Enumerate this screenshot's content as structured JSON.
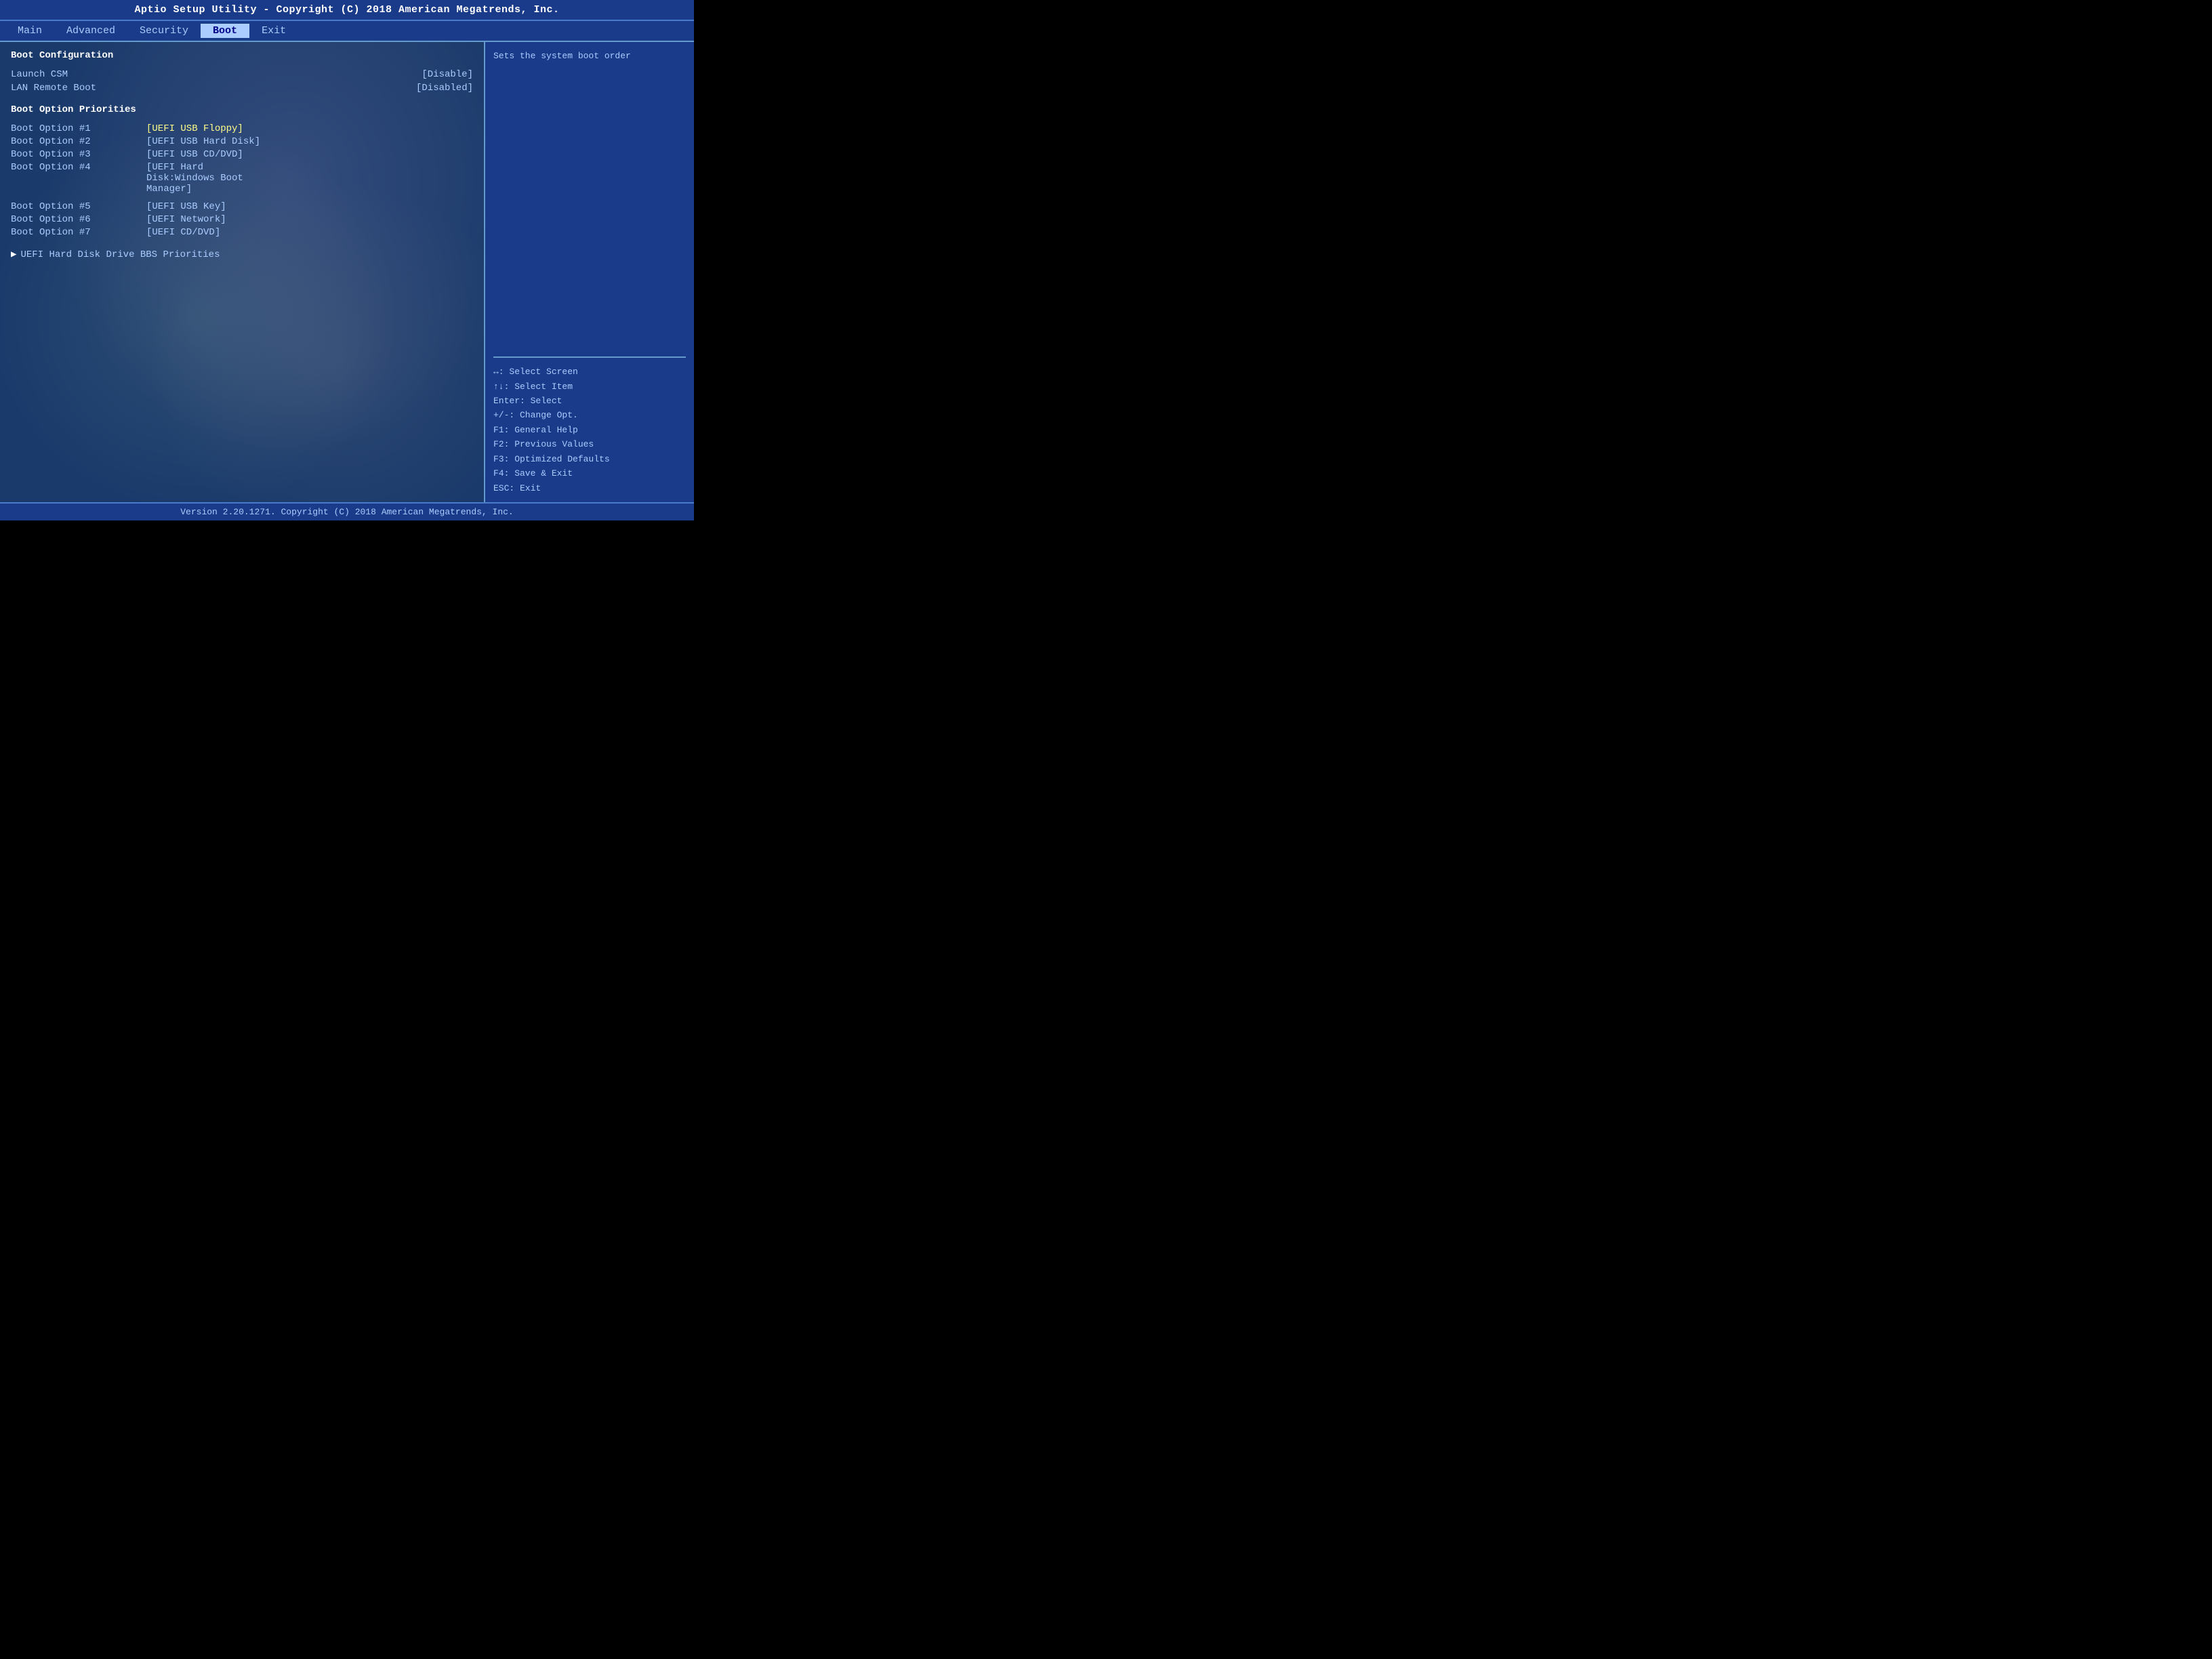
{
  "title_bar": {
    "text": "Aptio Setup Utility - Copyright (C) 2018 American Megatrends, Inc."
  },
  "menu": {
    "items": [
      {
        "label": "Main",
        "active": false
      },
      {
        "label": "Advanced",
        "active": false
      },
      {
        "label": "Security",
        "active": false
      },
      {
        "label": "Boot",
        "active": true
      },
      {
        "label": "Exit",
        "active": false
      }
    ]
  },
  "left_panel": {
    "section_title": "Boot Configuration",
    "settings": [
      {
        "label": "Launch CSM",
        "value": "[Disable]"
      },
      {
        "label": "LAN Remote Boot",
        "value": "[Disabled]"
      }
    ],
    "boot_priorities_label": "Boot Option Priorities",
    "boot_options": [
      {
        "label": "Boot Option #1",
        "value": "[UEFI USB Floppy]",
        "selected": true
      },
      {
        "label": "Boot Option #2",
        "value": "[UEFI USB Hard Disk]"
      },
      {
        "label": "Boot Option #3",
        "value": "[UEFI USB CD/DVD]"
      },
      {
        "label": "Boot Option #4",
        "value": "[UEFI Hard Disk:Windows Boot Manager]"
      },
      {
        "label": "Boot Option #5",
        "value": "[UEFI USB Key]"
      },
      {
        "label": "Boot Option #6",
        "value": "[UEFI Network]"
      },
      {
        "label": "Boot Option #7",
        "value": "[UEFI CD/DVD]"
      }
    ],
    "submenu": {
      "arrow": "▶",
      "label": "UEFI Hard Disk Drive BBS Priorities"
    }
  },
  "right_panel": {
    "top_text": "Sets the system boot order",
    "help_lines": [
      "↔: Select Screen",
      "↑↓: Select Item",
      "Enter: Select",
      "+/-: Change Opt.",
      "F1: General Help",
      "F2: Previous Values",
      "F3: Optimized Defaults",
      "F4: Save & Exit",
      "ESC: Exit"
    ]
  },
  "footer": {
    "text": "Version 2.20.1271. Copyright (C) 2018 American Megatrends, Inc."
  }
}
